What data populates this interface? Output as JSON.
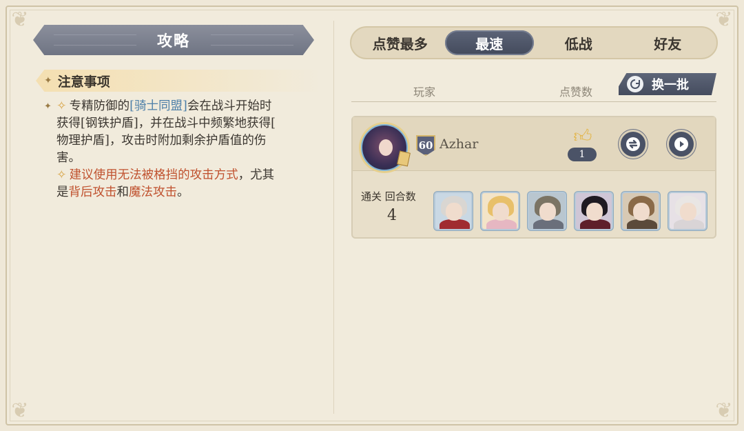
{
  "left_panel": {
    "title": "攻略",
    "section_title": "注意事项",
    "note1": {
      "prefix": "专精防御的",
      "ally": "[骑士同盟]",
      "text1": "会在战斗开始时",
      "text2": "获得[钢铁护盾]，并在战斗中频繁地获得[",
      "text3": "物理护盾]，攻击时附加剩余护盾值的伤",
      "text4": "害。"
    },
    "note2": {
      "highlight1": "建议使用无法被格挡的攻击方式",
      "text1": "，尤其",
      "text2": "是",
      "highlight2": "背后攻击",
      "text3": "和",
      "highlight3": "魔法攻击",
      "text4": "。"
    }
  },
  "tabs": [
    {
      "label": "点赞最多",
      "active": false
    },
    {
      "label": "最速",
      "active": true
    },
    {
      "label": "低战",
      "active": false
    },
    {
      "label": "好友",
      "active": false
    }
  ],
  "list_header": {
    "player": "玩家",
    "likes": "点赞数",
    "refresh": "换一批"
  },
  "entry": {
    "level": "60",
    "name": "Azhar",
    "likes": "1",
    "clear_label": "通关 回合数",
    "turns": "4",
    "team": [
      {
        "hair": "#d9d6d2",
        "body": "#a02c30",
        "bg": "#c9d8e4"
      },
      {
        "hair": "#e8c06a",
        "body": "#e6b7c2",
        "bg": "#f3e4c8"
      },
      {
        "hair": "#7b7464",
        "body": "#6a6f7b",
        "bg": "#b9c6cf"
      },
      {
        "hair": "#1e1a22",
        "body": "#5e1f2a",
        "bg": "#cfc6d6"
      },
      {
        "hair": "#8a6a48",
        "body": "#5b4a3a",
        "bg": "#d7c9b4"
      },
      {
        "hair": "#e9e6e4",
        "body": "#d9d4d6",
        "bg": "#e7e1e6"
      }
    ]
  },
  "colors": {
    "accent_dark": "#4b5367",
    "highlight_blue": "#4d7fa8",
    "highlight_red": "#c0522f",
    "gold": "#d8a64a"
  }
}
